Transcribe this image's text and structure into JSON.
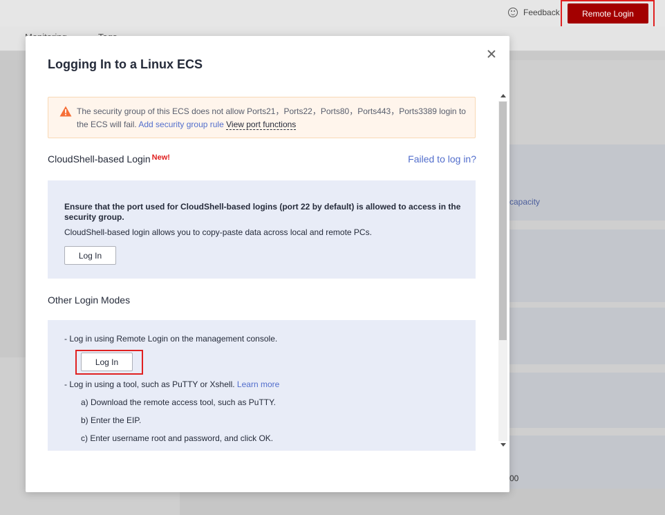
{
  "header": {
    "feedback_label": "Feedback",
    "remote_login_label": "Remote Login",
    "tabs": [
      "Monitoring",
      "Tags"
    ]
  },
  "background": {
    "capacity_text": "capacity",
    "value_text": "00"
  },
  "modal": {
    "title": "Logging In to a Linux ECS",
    "warning": {
      "text": "The security group of this ECS does not allow Ports21，Ports22，Ports80，Ports443，Ports3389 login to the ECS will fail.",
      "add_rule_link": "Add security group rule",
      "view_ports_link": "View port functions"
    },
    "cloudshell": {
      "title": "CloudShell-based Login",
      "badge": "New!",
      "failed_link": "Failed to log in?",
      "note": "Ensure that the port used for CloudShell-based logins (port 22 by default) is allowed to access in the security group.",
      "description": "CloudShell-based login allows you to copy-paste data across local and remote PCs.",
      "button_label": "Log In"
    },
    "other": {
      "title": "Other Login Modes",
      "remote_line": "- Log in using Remote Login on the management console.",
      "button_label": "Log In",
      "tool_line": "- Log in using a tool, such as PuTTY or Xshell.",
      "learn_more": "Learn more",
      "steps": [
        "a) Download the remote access tool, such as PuTTY.",
        "b) Enter the EIP.",
        "c) Enter username root and password, and click OK."
      ]
    }
  },
  "colors": {
    "brand_red": "#a30000",
    "highlight_red": "#e02020",
    "link_blue": "#526ecc",
    "info_bg": "#e8ecf7",
    "warning_bg": "#fff5ec"
  },
  "icons": [
    "feedback-smile-icon",
    "close-icon",
    "warning-icon",
    "scroll-up-icon",
    "scroll-down-icon"
  ]
}
